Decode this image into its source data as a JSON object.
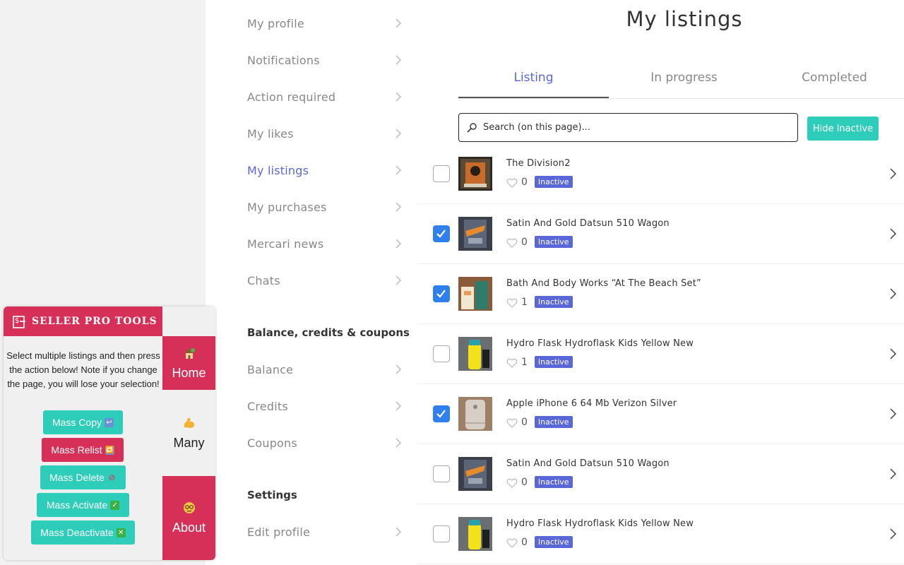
{
  "sidebar": {
    "items": [
      {
        "label": "My profile"
      },
      {
        "label": "Notifications"
      },
      {
        "label": "Action required"
      },
      {
        "label": "My likes"
      },
      {
        "label": "My listings",
        "active": true
      },
      {
        "label": "My purchases"
      },
      {
        "label": "Mercari news"
      },
      {
        "label": "Chats"
      }
    ],
    "balance_heading": "Balance, credits & coupons",
    "balance_items": [
      {
        "label": "Balance"
      },
      {
        "label": "Credits"
      },
      {
        "label": "Coupons"
      }
    ],
    "settings_heading": "Settings",
    "settings_items": [
      {
        "label": "Edit profile"
      }
    ]
  },
  "main": {
    "title": "My listings",
    "tabs": [
      {
        "label": "Listing",
        "active": true
      },
      {
        "label": "In progress"
      },
      {
        "label": "Completed"
      }
    ],
    "search_placeholder": "Search (on this page)...",
    "hide_inactive_label": "Hide Inactive",
    "listings": [
      {
        "name": "The Division2",
        "likes": "0",
        "status": "Inactive",
        "checked": false,
        "thumb": "division"
      },
      {
        "name": "Satin And Gold Datsun 510 Wagon",
        "likes": "0",
        "status": "Inactive",
        "checked": true,
        "thumb": "hotwheels"
      },
      {
        "name": "Bath And Body Works “At The Beach Set”",
        "likes": "1",
        "status": "Inactive",
        "checked": true,
        "thumb": "lotion"
      },
      {
        "name": "Hydro Flask Hydroflask Kids Yellow New",
        "likes": "1",
        "status": "Inactive",
        "checked": false,
        "thumb": "flask"
      },
      {
        "name": "Apple iPhone 6 64 Mb Verizon Silver",
        "likes": "0",
        "status": "Inactive",
        "checked": true,
        "thumb": "iphone"
      },
      {
        "name": "Satin And Gold Datsun 510 Wagon",
        "likes": "0",
        "status": "Inactive",
        "checked": false,
        "thumb": "hotwheels"
      },
      {
        "name": "Hydro Flask Hydroflask Kids Yellow New",
        "likes": "0",
        "status": "Inactive",
        "checked": false,
        "thumb": "flask"
      }
    ]
  },
  "extension": {
    "title": "SELLER PRO TOOLS",
    "description": "Select multiple listings and then press the action below! Note if you change the page, you will lose your selection!",
    "buttons": {
      "mass_copy": "Mass Copy",
      "mass_relist": "Mass Relist",
      "mass_delete": "Mass Delete",
      "mass_activate": "Mass Activate",
      "mass_deactivate": "Mass Deactivate"
    },
    "nav": {
      "home": "Home",
      "many": "Many",
      "about": "About"
    }
  },
  "colors": {
    "accent": "#5a67d8",
    "teal": "#2ecdb9",
    "pink": "#d63058",
    "checkbox": "#2f80ed"
  }
}
